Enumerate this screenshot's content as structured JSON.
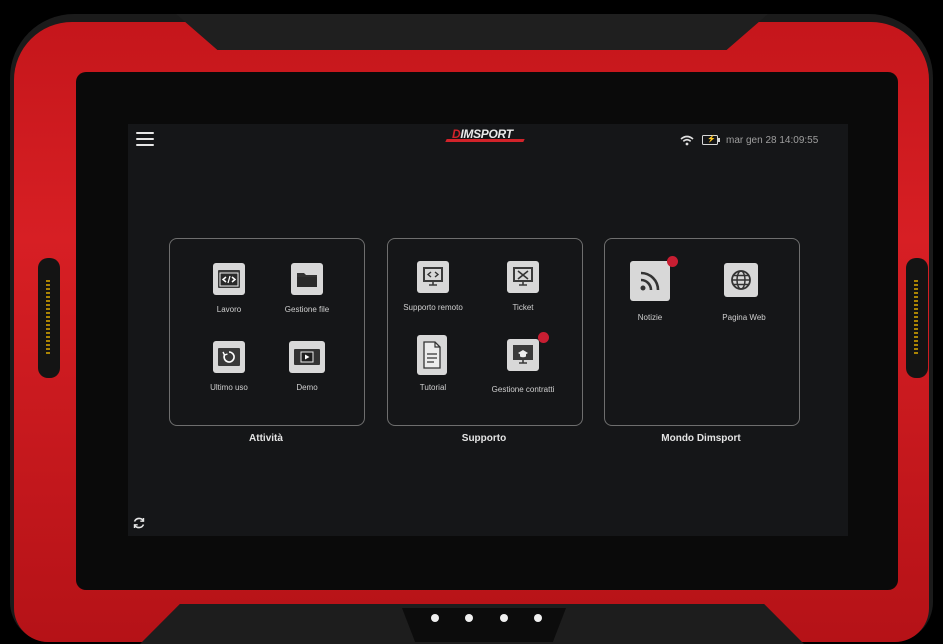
{
  "header": {
    "menu_icon": "hamburger-menu-icon",
    "logo_text": "DIMSPORT",
    "datetime": "mar gen 28  14:09:55",
    "wifi_icon": "wifi-icon",
    "battery_icon": "battery-charging-icon"
  },
  "panels": [
    {
      "title": "Attività",
      "tiles": [
        {
          "label": "Lavoro",
          "icon": "code-window-icon"
        },
        {
          "label": "Gestione file",
          "icon": "folder-icon"
        },
        {
          "label": "Ultimo uso",
          "icon": "history-icon"
        },
        {
          "label": "Demo",
          "icon": "play-video-icon"
        }
      ]
    },
    {
      "title": "Supporto",
      "tiles": [
        {
          "label": "Supporto remoto",
          "icon": "remote-desktop-icon"
        },
        {
          "label": "Ticket",
          "icon": "ticket-tools-icon"
        },
        {
          "label": "Tutorial",
          "icon": "document-icon"
        },
        {
          "label": "Gestione contratti",
          "icon": "contract-monitor-icon",
          "notification": true
        }
      ]
    },
    {
      "title": "Mondo Dimsport",
      "tiles": [
        {
          "label": "Notizie",
          "icon": "rss-icon",
          "notification": true
        },
        {
          "label": "Pagina Web",
          "icon": "globe-icon"
        }
      ]
    }
  ],
  "footer": {
    "refresh_icon": "refresh-icon"
  },
  "colors": {
    "frame_red": "#d71f24",
    "badge_red": "#c81e32",
    "screen_bg": "#151618"
  }
}
